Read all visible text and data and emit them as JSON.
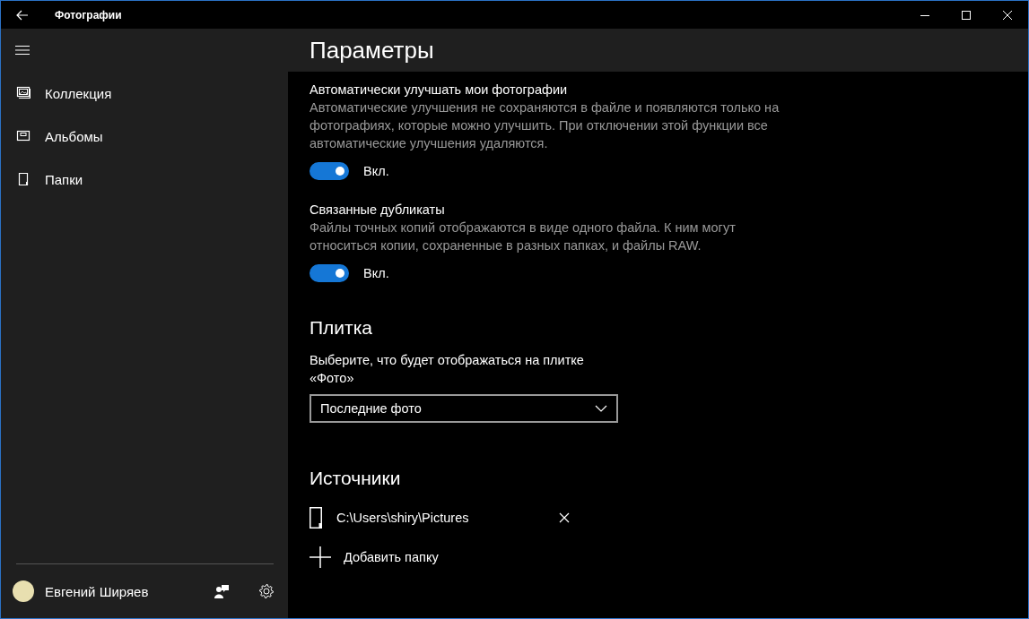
{
  "window": {
    "title": "Фотографии"
  },
  "sidebar": {
    "items": [
      {
        "kind": "collection",
        "label": "Коллекция"
      },
      {
        "kind": "albums",
        "label": "Альбомы"
      },
      {
        "kind": "folders",
        "label": "Папки"
      }
    ]
  },
  "account": {
    "name": "Евгений Ширяев"
  },
  "settings": {
    "title": "Параметры",
    "toggles": [
      {
        "label": "Автоматически улучшать мои фотографии",
        "description": "Автоматические улучшения не сохраняются в файле и появляются только на фотографиях, которые можно улучшить. При отключении этой функции все автоматические улучшения удаляются.",
        "on": true,
        "state_label": "Вкл."
      },
      {
        "label": "Связанные дубликаты",
        "description": "Файлы точных копий отображаются в виде одного файла. К ним могут относиться копии, сохраненные в разных папках, и файлы RAW.",
        "on": true,
        "state_label": "Вкл."
      }
    ]
  },
  "tile": {
    "heading": "Плитка",
    "prompt": "Выберите, что будет отображаться на плитке «Фото»",
    "dropdown": {
      "value": "Последние фото"
    }
  },
  "sources": {
    "heading": "Источники",
    "folders": [
      {
        "path": "C:\\Users\\shiry\\Pictures"
      }
    ],
    "add_label": "Добавить папку"
  }
}
